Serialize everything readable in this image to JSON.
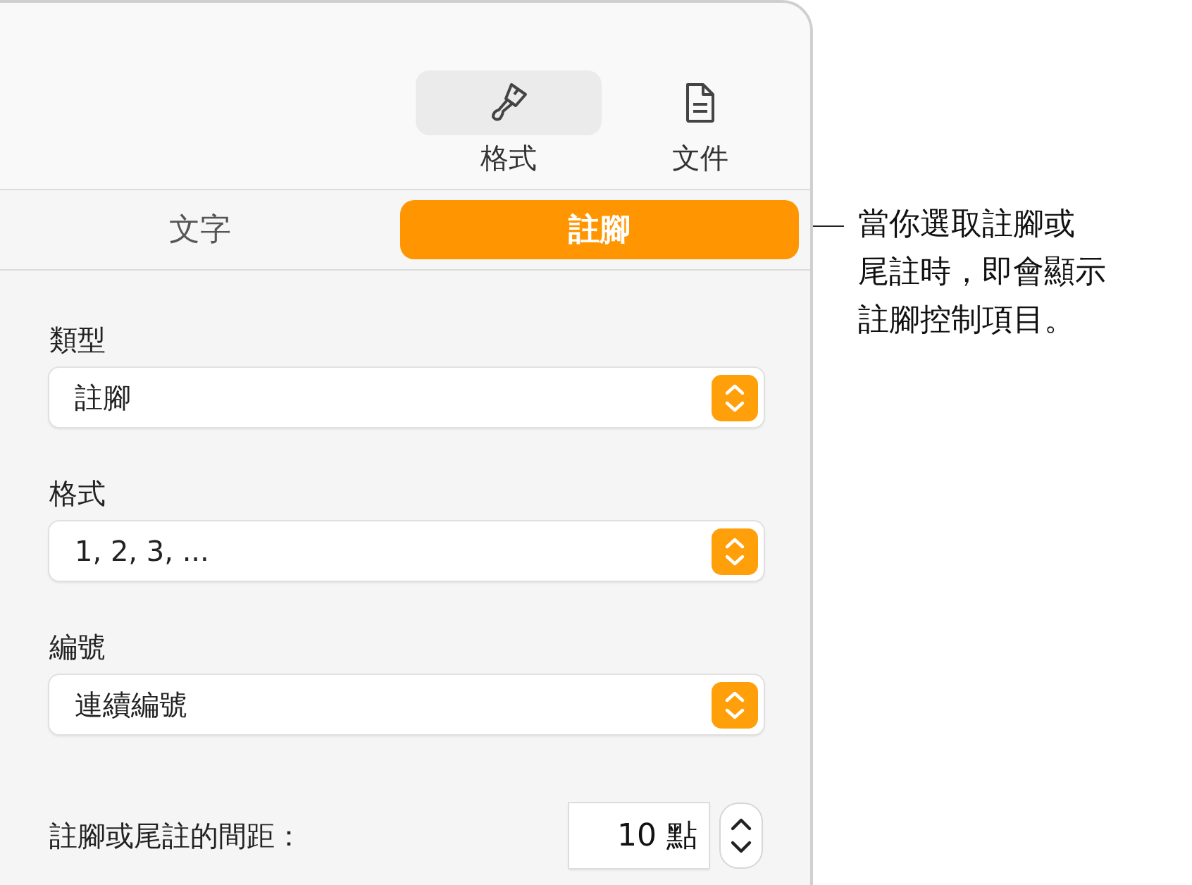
{
  "toolbar": {
    "buttons": [
      {
        "label": "格式",
        "kind": "brush",
        "selected": true
      },
      {
        "label": "文件",
        "kind": "document",
        "selected": false
      }
    ]
  },
  "tabs": [
    {
      "label": "文字",
      "selected": false
    },
    {
      "label": "註腳",
      "selected": true
    }
  ],
  "fields": [
    {
      "label": "類型",
      "value": "註腳"
    },
    {
      "label": "格式",
      "value": "1, 2, 3, ..."
    },
    {
      "label": "編號",
      "value": "連續編號"
    }
  ],
  "spacing": {
    "label": "註腳或尾註的間距：",
    "value": "10 點"
  },
  "callout": {
    "lines": [
      "當你選取註腳或",
      "尾註時，即會顯示",
      "註腳控制項目。"
    ]
  }
}
